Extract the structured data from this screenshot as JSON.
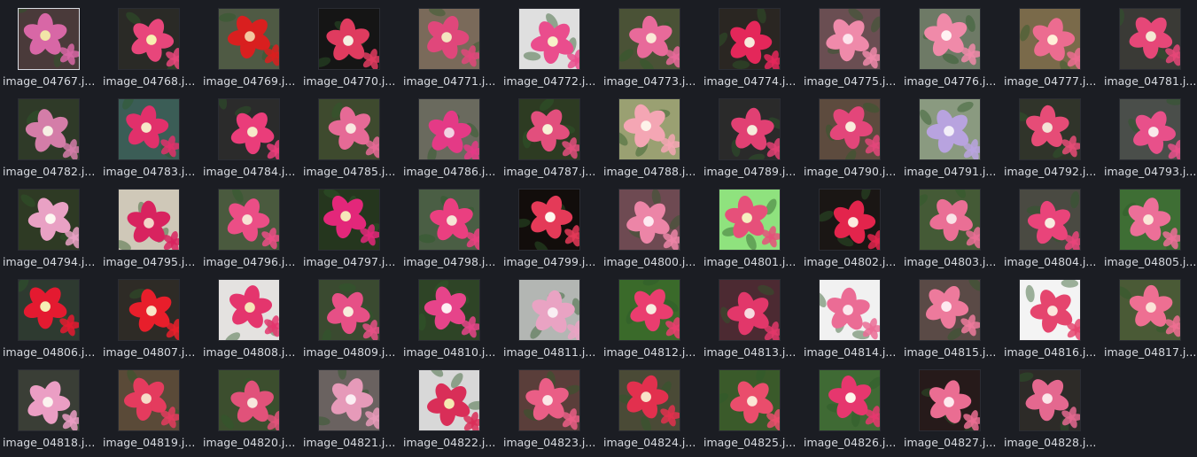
{
  "file_browser": {
    "items": [
      {
        "name": "image_04767.j...",
        "bg": "#4a3a3a",
        "petal": "#d867a6",
        "center": "#f2e6a8",
        "selected": true
      },
      {
        "name": "image_04768.j...",
        "bg": "#2a2a26",
        "petal": "#e8467b",
        "center": "#f7f0b0"
      },
      {
        "name": "image_04769.j...",
        "bg": "#4f5a44",
        "petal": "#d91f1f",
        "center": "#f3c7a0"
      },
      {
        "name": "image_04770.j...",
        "bg": "#151515",
        "petal": "#df3b5f",
        "center": "#f4efe1"
      },
      {
        "name": "image_04771.j...",
        "bg": "#7a6a5a",
        "petal": "#e0477b",
        "center": "#f3e6c0"
      },
      {
        "name": "image_04772.j...",
        "bg": "#dfdfdf",
        "petal": "#ea4d8d",
        "center": "#f7f2c8"
      },
      {
        "name": "image_04773.j...",
        "bg": "#4a5236",
        "petal": "#e86a9a",
        "center": "#fae9d7"
      },
      {
        "name": "image_04774.j...",
        "bg": "#2a2622",
        "petal": "#e4275a",
        "center": "#f6eadc"
      },
      {
        "name": "image_04775.j...",
        "bg": "#6a4e52",
        "petal": "#ef8aaa",
        "center": "#fde4ec"
      },
      {
        "name": "image_04776.j...",
        "bg": "#6e7a66",
        "petal": "#f08aa9",
        "center": "#fff3f3"
      },
      {
        "name": "image_04777.j...",
        "bg": "#7a6a4a",
        "petal": "#ec6c90",
        "center": "#fff0d8"
      },
      {
        "name": "image_04781.j...",
        "bg": "#3a3a36",
        "petal": "#e64778",
        "center": "#f4e9d4"
      },
      {
        "name": "image_04782.j...",
        "bg": "#2f3a28",
        "petal": "#d47da8",
        "center": "#f6efe4"
      },
      {
        "name": "image_04783.j...",
        "bg": "#3b5d56",
        "petal": "#e1306b",
        "center": "#f6e7c8"
      },
      {
        "name": "image_04784.j...",
        "bg": "#2b2b2b",
        "petal": "#ea3d7a",
        "center": "#f6e9c8"
      },
      {
        "name": "image_04785.j...",
        "bg": "#3e4a2e",
        "petal": "#e66a96",
        "center": "#f8e7e0"
      },
      {
        "name": "image_04786.j...",
        "bg": "#6a6a5e",
        "petal": "#e43a86",
        "center": "#f1d2e2"
      },
      {
        "name": "image_04787.j...",
        "bg": "#2d3b22",
        "petal": "#e24f7d",
        "center": "#f7f1d6"
      },
      {
        "name": "image_04788.j...",
        "bg": "#9aa072",
        "petal": "#f4a6b4",
        "center": "#fdf3ea"
      },
      {
        "name": "image_04789.j...",
        "bg": "#2a2a2a",
        "petal": "#e14073",
        "center": "#f5ecdb"
      },
      {
        "name": "image_04790.j...",
        "bg": "#5d4b3e",
        "petal": "#e3467a",
        "center": "#f9ecdc"
      },
      {
        "name": "image_04791.j...",
        "bg": "#8a9a80",
        "petal": "#b8a3df",
        "center": "#f2eef8"
      },
      {
        "name": "image_04792.j...",
        "bg": "#30342a",
        "petal": "#e64c77",
        "center": "#f3e4d6"
      },
      {
        "name": "image_04793.j...",
        "bg": "#4a4e4a",
        "petal": "#e8508a",
        "center": "#f9e8ea"
      },
      {
        "name": "image_04794.j...",
        "bg": "#2e3a24",
        "petal": "#e9a1c4",
        "center": "#fdf7f2"
      },
      {
        "name": "image_04795.j...",
        "bg": "#cfc8b8",
        "petal": "#d8235f",
        "center": "#f2d6c8"
      },
      {
        "name": "image_04796.j...",
        "bg": "#4a5a3e",
        "petal": "#eb4e86",
        "center": "#f7e2d5"
      },
      {
        "name": "image_04797.j...",
        "bg": "#25361e",
        "petal": "#e3277a",
        "center": "#f6e5b9"
      },
      {
        "name": "image_04798.j...",
        "bg": "#4a5e44",
        "petal": "#ea3f80",
        "center": "#f6e5d6"
      },
      {
        "name": "image_04799.j...",
        "bg": "#120d0b",
        "petal": "#e43a58",
        "center": "#fdf7ee"
      },
      {
        "name": "image_04800.j...",
        "bg": "#6e4a52",
        "petal": "#ec85a7",
        "center": "#fdeaf1"
      },
      {
        "name": "image_04801.j...",
        "bg": "#8fe27e",
        "petal": "#e6507a",
        "center": "#f5efc0"
      },
      {
        "name": "image_04802.j...",
        "bg": "#1a1614",
        "petal": "#e3244c",
        "center": "#fbeadf"
      },
      {
        "name": "image_04803.j...",
        "bg": "#445a36",
        "petal": "#ea6f95",
        "center": "#f9e3e7"
      },
      {
        "name": "image_04804.j...",
        "bg": "#4a4a42",
        "petal": "#e9447a",
        "center": "#f7ece0"
      },
      {
        "name": "image_04805.j...",
        "bg": "#3e6e34",
        "petal": "#ec6f98",
        "center": "#fbe6d8"
      },
      {
        "name": "image_04806.j...",
        "bg": "#2e3a30",
        "petal": "#e41a30",
        "center": "#f6eeb4"
      },
      {
        "name": "image_04807.j...",
        "bg": "#2e2b26",
        "petal": "#e81e2b",
        "center": "#f8e6c8"
      },
      {
        "name": "image_04808.j...",
        "bg": "#e4e2e0",
        "petal": "#e4356d",
        "center": "#f5e6b8"
      },
      {
        "name": "image_04809.j...",
        "bg": "#3a4a30",
        "petal": "#e65086",
        "center": "#f7eddc"
      },
      {
        "name": "image_04810.j...",
        "bg": "#2e4426",
        "petal": "#e6448a",
        "center": "#fdf0f3"
      },
      {
        "name": "image_04811.j...",
        "bg": "#b3b6b3",
        "petal": "#e9a3c3",
        "center": "#f9eef3"
      },
      {
        "name": "image_04812.j...",
        "bg": "#3a6a2a",
        "petal": "#ea3d6f",
        "center": "#f6ece0"
      },
      {
        "name": "image_04813.j...",
        "bg": "#4c2a32",
        "petal": "#e2376a",
        "center": "#f6dbe0"
      },
      {
        "name": "image_04814.j...",
        "bg": "#f1f1f1",
        "petal": "#eb6c95",
        "center": "#fbe8ee"
      },
      {
        "name": "image_04815.j...",
        "bg": "#5a4a46",
        "petal": "#ed7a9c",
        "center": "#fdeaf0"
      },
      {
        "name": "image_04816.j...",
        "bg": "#f4f4f4",
        "petal": "#e5456e",
        "center": "#fbe6dc"
      },
      {
        "name": "image_04817.j...",
        "bg": "#4a5a36",
        "petal": "#ee6f92",
        "center": "#fbe3d8"
      },
      {
        "name": "image_04818.j...",
        "bg": "#3a3e36",
        "petal": "#eb9ec4",
        "center": "#fbf2ef"
      },
      {
        "name": "image_04819.j...",
        "bg": "#5a4a38",
        "petal": "#e43b5e",
        "center": "#f6dcc8"
      },
      {
        "name": "image_04820.j...",
        "bg": "#3c4e2e",
        "petal": "#e1527a",
        "center": "#f7e7dc"
      },
      {
        "name": "image_04821.j...",
        "bg": "#6a6260",
        "petal": "#e69ab9",
        "center": "#fbeef3"
      },
      {
        "name": "image_04822.j...",
        "bg": "#d8d8d8",
        "petal": "#d92e58",
        "center": "#f5eab2"
      },
      {
        "name": "image_04823.j...",
        "bg": "#5a3e3a",
        "petal": "#ea5e86",
        "center": "#fbe7e7"
      },
      {
        "name": "image_04824.j...",
        "bg": "#4a4a36",
        "petal": "#e2304e",
        "center": "#f8e2c8"
      },
      {
        "name": "image_04825.j...",
        "bg": "#3a5a2a",
        "petal": "#ea4d6c",
        "center": "#fbe6d6"
      },
      {
        "name": "image_04826.j...",
        "bg": "#3f6a34",
        "petal": "#e6376e",
        "center": "#fdf6ec"
      },
      {
        "name": "image_04827.j...",
        "bg": "#261a1a",
        "petal": "#ea6d92",
        "center": "#fde9ee"
      },
      {
        "name": "image_04828.j...",
        "bg": "#2d2b28",
        "petal": "#e4688f",
        "center": "#fbe6e9"
      }
    ]
  }
}
